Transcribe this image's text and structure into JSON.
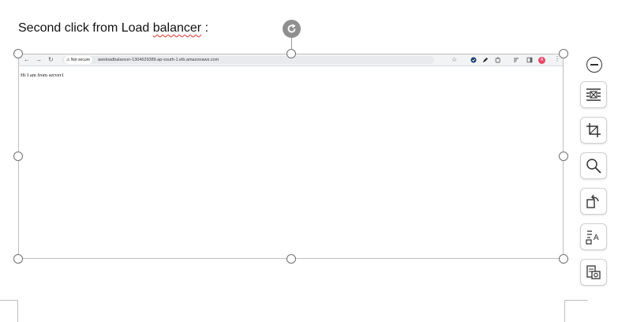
{
  "document": {
    "caption_prefix": "Second click from Load ",
    "caption_misspelled": "balancer",
    "caption_suffix": " :"
  },
  "browser_screenshot": {
    "security_label": "⚠ Not secure",
    "url": "awsloadbalancer-1304629389.ap-south-1.elb.amazonaws.com",
    "profile_initial": "A",
    "page_text": "Hi I am from server1"
  },
  "colors": {
    "spellcheck_underline": "#d9302c",
    "selection_handle": "#6f6f6f",
    "profile_badge": "#e8476b"
  },
  "side_toolbar": {
    "icons": [
      "collapse-icon",
      "wrap-text-icon",
      "crop-icon",
      "zoom-icon",
      "replace-image-icon",
      "extract-text-icon",
      "image-properties-icon"
    ]
  }
}
